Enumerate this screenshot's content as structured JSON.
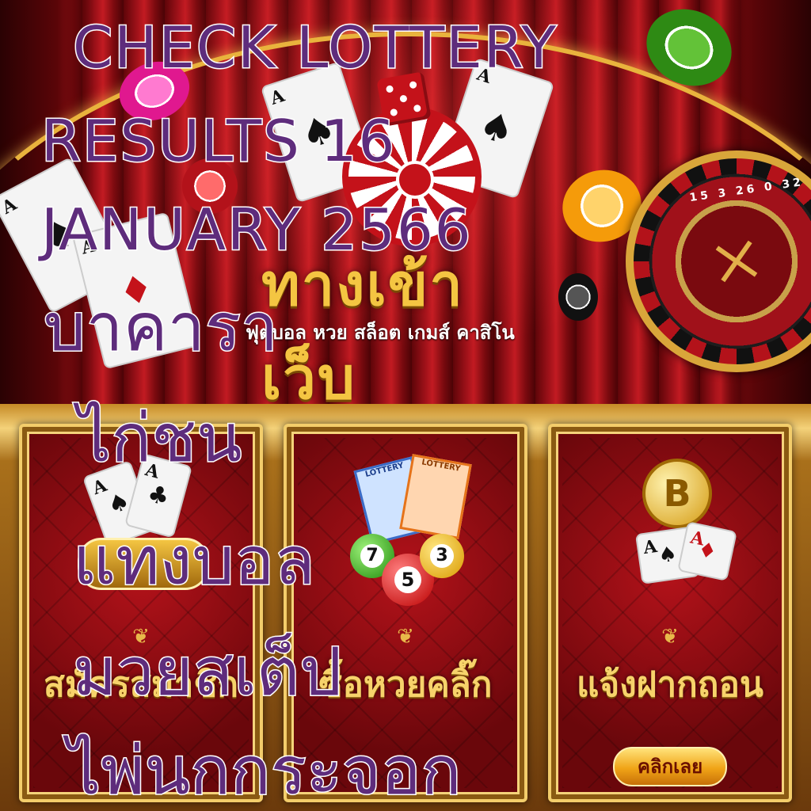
{
  "headline": {
    "line1": "CHECK LOTTERY",
    "line2": "RESULTS 16",
    "line3": "JANUARY 2566",
    "thai": [
      "บาคารา",
      "ไก่ชน",
      "แทงบอล",
      "มวยสเต็ป",
      "ไพ่นกกระจอก"
    ]
  },
  "banner": {
    "logo_text": "ทางเข้าเว็บ",
    "subtitle": "ฟุตบอล หวย สล็อต เกมส์ คาสิโน"
  },
  "panels": [
    {
      "title": "สมัครสมาชิก",
      "icon": "casino-cards-icon"
    },
    {
      "title": "ซื้อหวยคลิ๊ก",
      "icon": "lottery-balls-icon",
      "ticket_label": "LOTTERY",
      "balls": [
        "7",
        "5",
        "3"
      ]
    },
    {
      "title": "แจ้งฝากถอน",
      "icon": "bitcoin-cards-icon",
      "coin_label": "B"
    }
  ],
  "cta": {
    "label": "คลิกเลย"
  },
  "roulette": {
    "numbers": [
      "15",
      "3",
      "26",
      "0",
      "32"
    ]
  },
  "colors": {
    "headline_fill": "#5e2c7c",
    "headline_stroke": "#ffffff",
    "gold": "#f3cd6b",
    "curtain_red": "#a3121a"
  }
}
